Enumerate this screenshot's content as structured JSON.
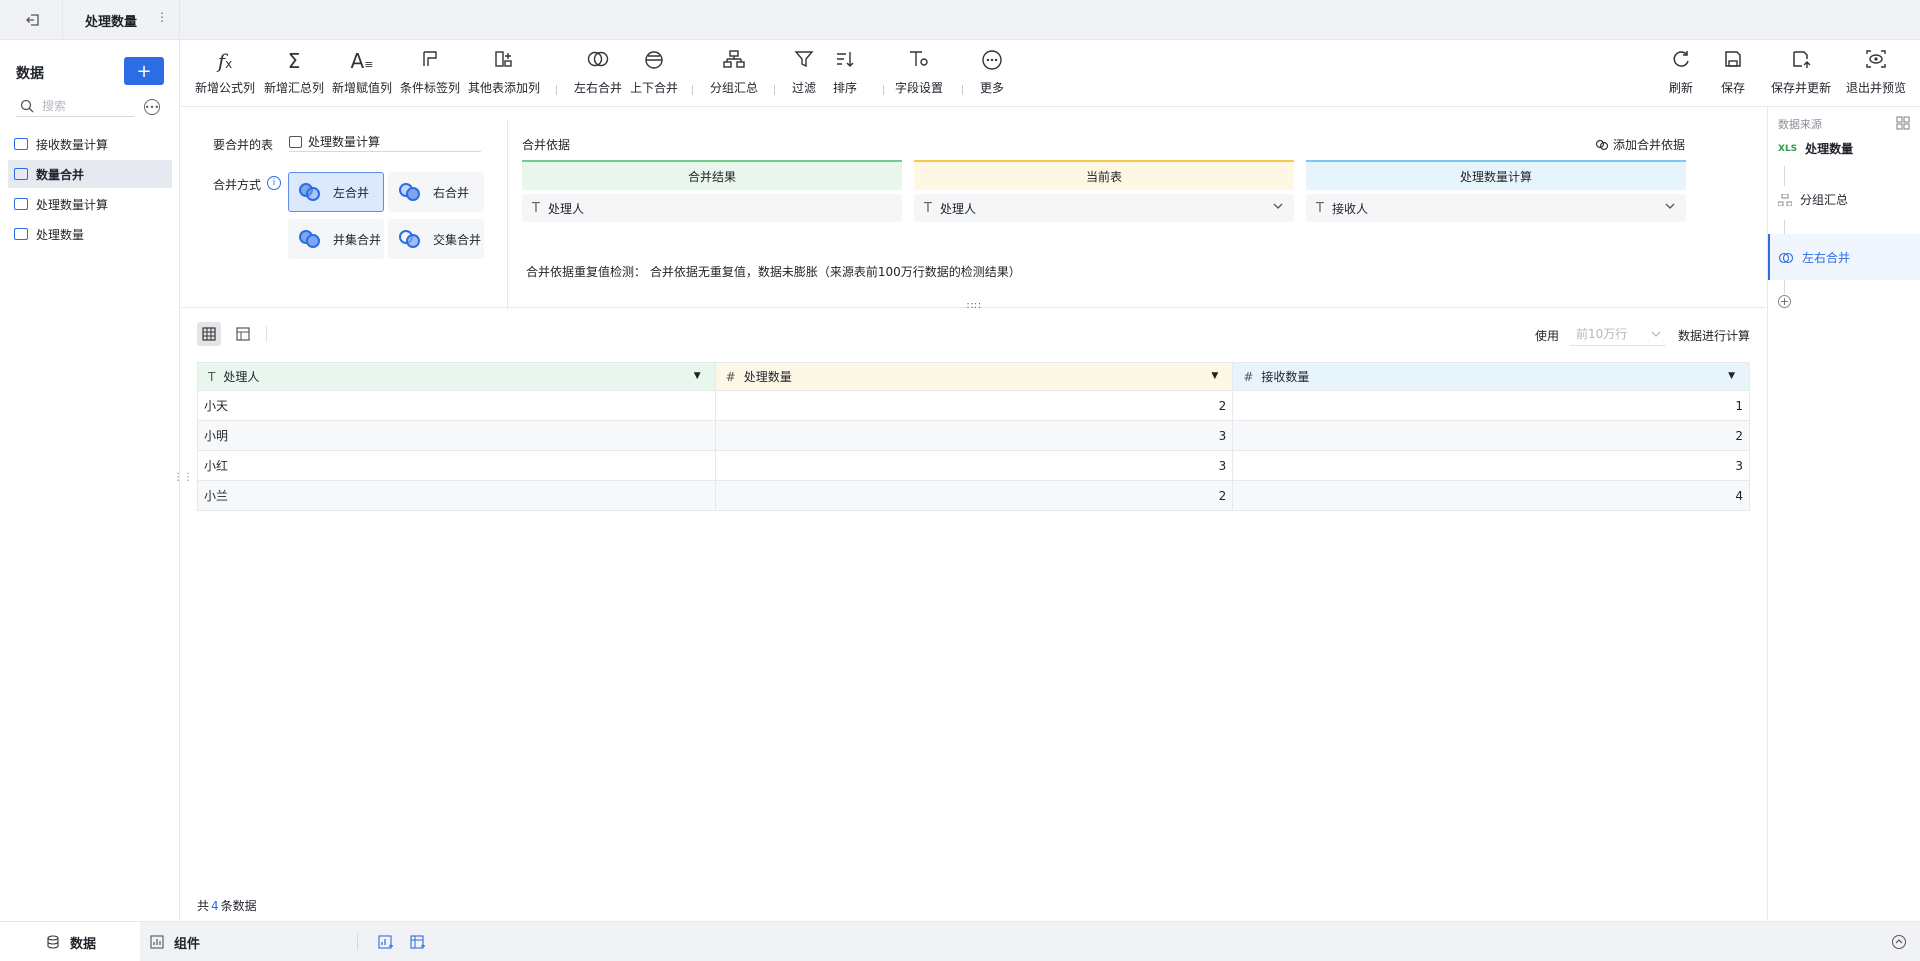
{
  "topbar": {
    "title": "处理数量"
  },
  "left": {
    "header": "数据",
    "add_label": "+",
    "search_placeholder": "搜索",
    "items": [
      {
        "label": "接收数量计算"
      },
      {
        "label": "数量合并"
      },
      {
        "label": "处理数量计算"
      },
      {
        "label": "处理数量"
      }
    ]
  },
  "toolbar": {
    "items": [
      {
        "label": "新增公式列",
        "icon": "fx-icon"
      },
      {
        "label": "新增汇总列",
        "icon": "sigma-icon"
      },
      {
        "label": "新增赋值列",
        "icon": "assign-icon"
      },
      {
        "label": "条件标签列",
        "icon": "flag-icon"
      },
      {
        "label": "其他表添加列",
        "icon": "add-column-icon"
      },
      {
        "label": "左右合并",
        "icon": "join-lr-icon"
      },
      {
        "label": "上下合并",
        "icon": "join-tb-icon"
      },
      {
        "label": "分组汇总",
        "icon": "group-icon"
      },
      {
        "label": "过滤",
        "icon": "filter-icon"
      },
      {
        "label": "排序",
        "icon": "sort-icon"
      },
      {
        "label": "字段设置",
        "icon": "field-settings-icon"
      },
      {
        "label": "更多",
        "icon": "more-icon"
      }
    ],
    "right": [
      {
        "label": "刷新",
        "icon": "refresh-icon"
      },
      {
        "label": "保存",
        "icon": "save-icon"
      },
      {
        "label": "保存并更新",
        "icon": "save-update-icon"
      },
      {
        "label": "退出并预览",
        "icon": "exit-preview-icon"
      }
    ]
  },
  "config": {
    "merge_table_label": "要合并的表",
    "merge_table_value": "处理数量计算",
    "merge_mode_label": "合并方式",
    "modes": [
      {
        "label": "左合并",
        "selected": true
      },
      {
        "label": "右合并",
        "selected": false
      },
      {
        "label": "并集合并",
        "selected": false
      },
      {
        "label": "交集合并",
        "selected": false
      }
    ],
    "basis_label": "合并依据",
    "add_basis_label": "添加合并依据",
    "columns": [
      {
        "header": "合并结果",
        "field": "处理人",
        "color": "#e8f6ec",
        "border": "#6fcf8a"
      },
      {
        "header": "当前表",
        "field": "处理人",
        "color": "#fdf7e4",
        "border": "#f2c94c"
      },
      {
        "header": "处理数量计算",
        "field": "接收人",
        "color": "#e6f4fb",
        "border": "#7cc7ee"
      }
    ],
    "check_text": "合并依据重复值检测： 合并依据无重复值，数据未膨胀（来源表前100万行数据的检测结果）"
  },
  "grid": {
    "use_label": "使用",
    "rows_option": "前10万行",
    "calc_label": "数据进行计算",
    "headers": [
      {
        "label": "处理人",
        "type_icon": "T",
        "bg": "#e9f6ee"
      },
      {
        "label": "处理数量",
        "type_icon": "#",
        "bg": "#fdf7e6"
      },
      {
        "label": "接收数量",
        "type_icon": "#",
        "bg": "#e8f4fb"
      }
    ],
    "rows": [
      [
        "小天",
        "2",
        "1"
      ],
      [
        "小明",
        "3",
        "2"
      ],
      [
        "小红",
        "3",
        "3"
      ],
      [
        "小兰",
        "2",
        "4"
      ]
    ],
    "total_prefix": "共",
    "total_count": "4",
    "total_suffix": "条数据"
  },
  "right": {
    "source_label": "数据来源",
    "steps": [
      {
        "label": "处理数量"
      },
      {
        "label": "分组汇总"
      },
      {
        "label": "左右合并"
      }
    ]
  },
  "bottom": {
    "tabs": [
      {
        "label": "数据"
      },
      {
        "label": "组件"
      }
    ]
  }
}
